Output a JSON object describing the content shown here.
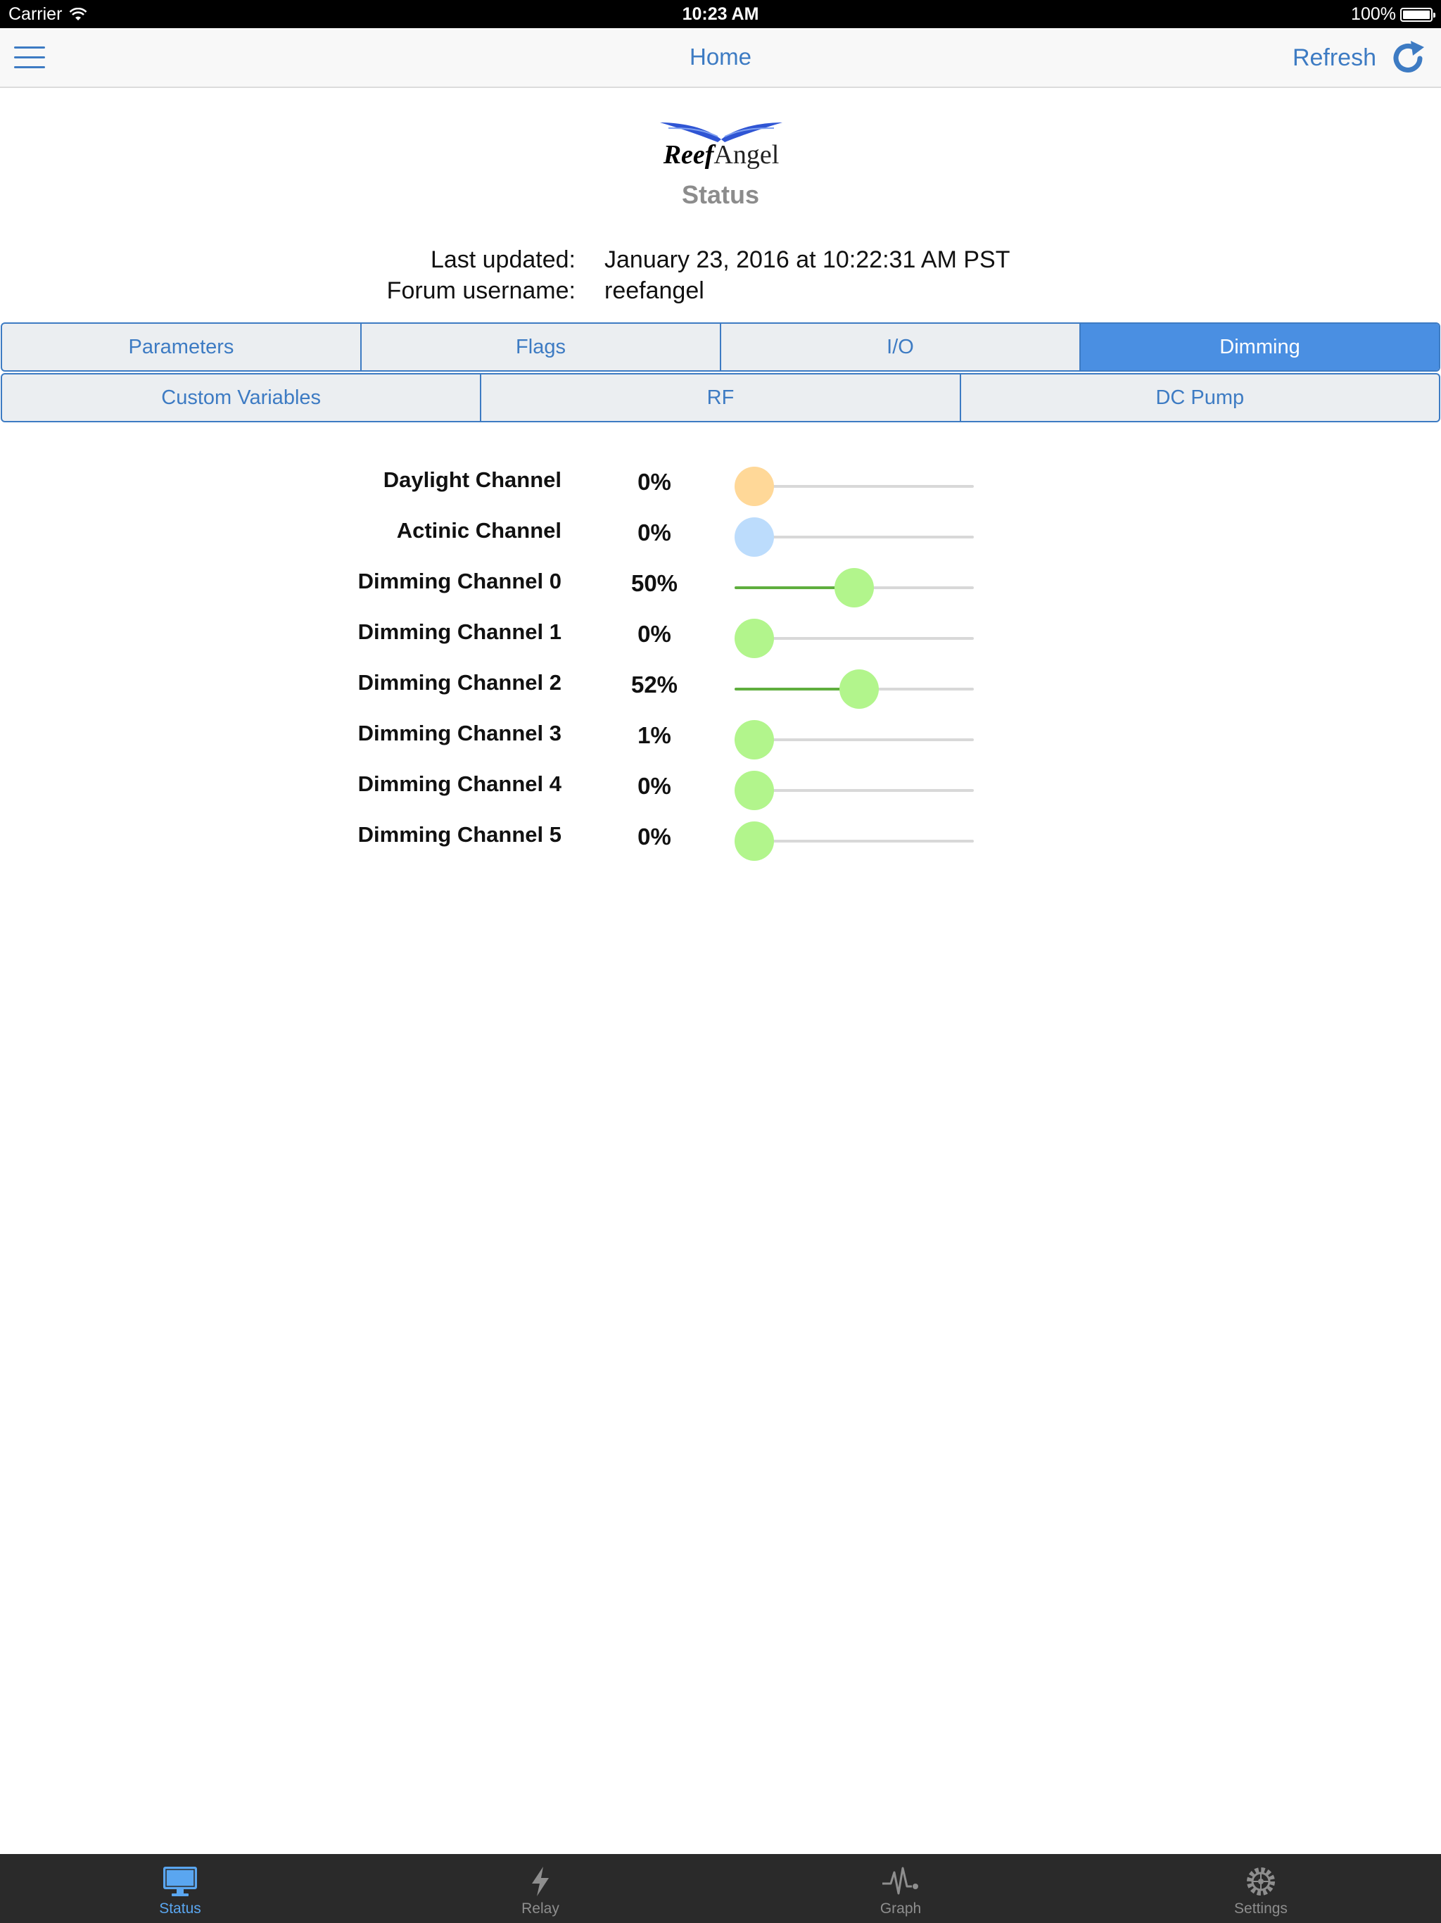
{
  "status_bar": {
    "carrier": "Carrier",
    "time": "10:23 AM",
    "battery": "100%"
  },
  "nav": {
    "title": "Home",
    "refresh_label": "Refresh",
    "menu_icon": "hamburger-menu-icon",
    "refresh_icon": "refresh-icon"
  },
  "header": {
    "logo_reef": "Reef",
    "logo_angel": "Angel",
    "title": "Status"
  },
  "info": {
    "last_updated_label": "Last updated:",
    "last_updated_value": "January 23, 2016 at 10:22:31 AM PST",
    "username_label": "Forum username:",
    "username_value": "reefangel"
  },
  "tabs_row1": [
    {
      "label": "Parameters",
      "active": false
    },
    {
      "label": "Flags",
      "active": false
    },
    {
      "label": "I/O",
      "active": false
    },
    {
      "label": "Dimming",
      "active": true
    }
  ],
  "tabs_row2": [
    {
      "label": "Custom Variables",
      "active": false
    },
    {
      "label": "RF",
      "active": false
    },
    {
      "label": "DC Pump",
      "active": false
    }
  ],
  "channels": [
    {
      "label": "Daylight Channel",
      "value": "0%",
      "level": 0,
      "knob_color": "#ffd898"
    },
    {
      "label": "Actinic Channel",
      "value": "0%",
      "level": 0,
      "knob_color": "#bcdcfc"
    },
    {
      "label": "Dimming Channel 0",
      "value": "50%",
      "level": 50,
      "knob_color": "#b2f58c"
    },
    {
      "label": "Dimming Channel 1",
      "value": "0%",
      "level": 0,
      "knob_color": "#b2f58c"
    },
    {
      "label": "Dimming Channel 2",
      "value": "52%",
      "level": 52,
      "knob_color": "#b2f58c"
    },
    {
      "label": "Dimming Channel 3",
      "value": "1%",
      "level": 1,
      "knob_color": "#b2f58c"
    },
    {
      "label": "Dimming Channel 4",
      "value": "0%",
      "level": 0,
      "knob_color": "#b2f58c"
    },
    {
      "label": "Dimming Channel 5",
      "value": "0%",
      "level": 0,
      "knob_color": "#b2f58c"
    }
  ],
  "tab_bar": [
    {
      "label": "Status",
      "icon": "monitor-icon",
      "active": true
    },
    {
      "label": "Relay",
      "icon": "lightning-bolt-icon",
      "active": false
    },
    {
      "label": "Graph",
      "icon": "pulse-graph-icon",
      "active": false
    },
    {
      "label": "Settings",
      "icon": "gear-icon",
      "active": false
    }
  ],
  "colors": {
    "accent": "#3d7bc3",
    "segment_active": "#4a8fe2",
    "tab_active": "#5aa6f0",
    "slider_fill": "#5fae3e"
  }
}
